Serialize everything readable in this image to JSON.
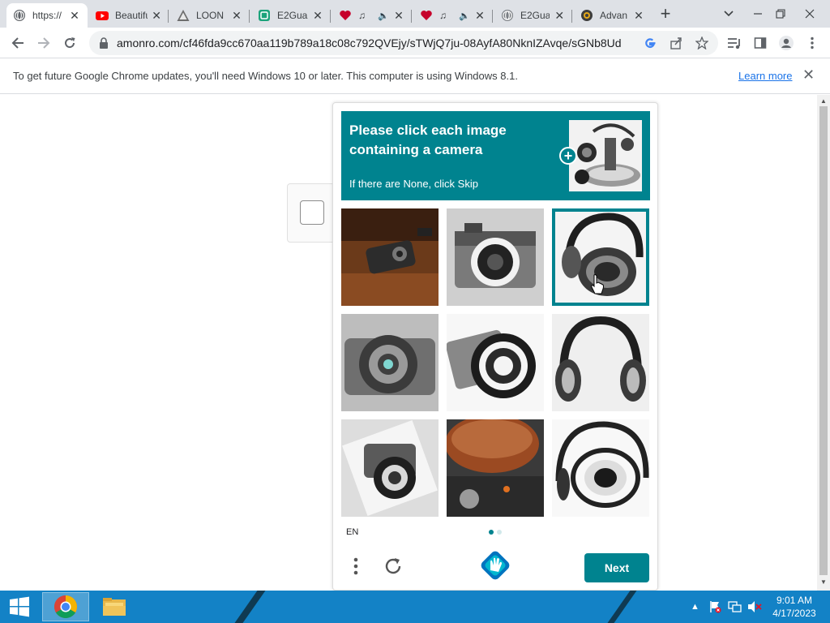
{
  "browser": {
    "tabs": [
      {
        "title": "https://",
        "icon": "globe-icon",
        "active": true
      },
      {
        "title": "Beautiful",
        "icon": "youtube-icon",
        "active": false
      },
      {
        "title": "LOON",
        "icon": "warning-triangle-icon",
        "active": false
      },
      {
        "title": "E2Gua",
        "icon": "e2guardian-icon",
        "active": false
      },
      {
        "title": "♫",
        "icon": "iheart-icon",
        "active": false,
        "audio": true
      },
      {
        "title": "♫",
        "icon": "iheart-icon",
        "active": false,
        "audio": true
      },
      {
        "title": "E2Gua",
        "icon": "globe-icon",
        "active": false
      },
      {
        "title": "Advan",
        "icon": "chrome-circle-icon",
        "active": false
      }
    ],
    "new_tab_label": "+",
    "url": "amonro.com/cf46fda9cc670aa119b789a18c08c792QVEjy/sTWjQ7ju-08AyfA80NknIZAvqe/sGNb8Ud"
  },
  "infobar": {
    "message": "To get future Google Chrome updates, you'll need Windows 10 or later. This computer is using Windows 8.1.",
    "link": "Learn more"
  },
  "captcha": {
    "prompt": "Please click each image containing a camera",
    "subtext": "If there are None, click Skip",
    "language": "EN",
    "next_label": "Next",
    "accent_color": "#00838f",
    "tiles": [
      {
        "subject": "camera",
        "selected": false
      },
      {
        "subject": "camera",
        "selected": false
      },
      {
        "subject": "headphones",
        "selected": true
      },
      {
        "subject": "camera",
        "selected": false
      },
      {
        "subject": "camera",
        "selected": false
      },
      {
        "subject": "headphones",
        "selected": false
      },
      {
        "subject": "camera",
        "selected": false
      },
      {
        "subject": "camera",
        "selected": false
      },
      {
        "subject": "headphones",
        "selected": false
      }
    ],
    "page_dots": [
      true,
      false
    ]
  },
  "taskbar": {
    "time": "9:01 AM",
    "date": "4/17/2023"
  }
}
